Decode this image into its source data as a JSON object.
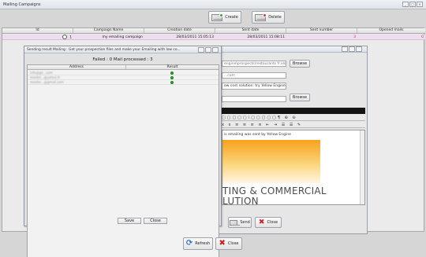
{
  "window": {
    "title": "Mailing Campaigns",
    "controls": [
      "_",
      "□",
      "×"
    ]
  },
  "toolbar": {
    "create_label": "Create",
    "delete_label": "Delete"
  },
  "campaigns_table": {
    "columns": [
      "Id",
      "Campaign Name",
      "Creation date",
      "Sent date",
      "Sent number",
      "Opened mails"
    ],
    "rows": [
      {
        "id": "1",
        "name": "my emailing campaign",
        "created": "28/03/2011 15:05:13",
        "sent": "28/03/2011 15:08:11",
        "sent_number": "3",
        "opened": "0"
      }
    ]
  },
  "editor_dialog": {
    "path_field": "engine\\prospects\\restaurants fr.xls",
    "email_field": "...com",
    "subject_field": "ow cost solution: try Yellow Engine",
    "browse1_label": "Browse",
    "browse2_label": "Browse",
    "body_intro": "is emailing was sent by Yellow Engine",
    "banner_line1": "TING & COMMERCIAL",
    "banner_line2": "LUTION",
    "send_label": "Send",
    "close_label": "Close"
  },
  "result_dialog": {
    "title": "Sending result Mailing : Get your prospection files and make your Emailing with low co...",
    "status": "Failed :  0    Mail processed :  3",
    "columns": [
      "Address",
      "Result"
    ],
    "rows": [
      {
        "address": "info@ge...com",
        "result": "ok"
      },
      {
        "address": "moxtel...@yahoo.fr",
        "result": "ok"
      },
      {
        "address": "moxter...@gmail.com",
        "result": "ok"
      }
    ],
    "save_label": "Save",
    "close_label": "Close"
  },
  "footer": {
    "refresh_label": "Refresh",
    "close_label": "Close"
  },
  "colors": {
    "selected_row": "#eeddee",
    "ok": "#2fb12f",
    "accent_orange": "#f7a21c"
  }
}
